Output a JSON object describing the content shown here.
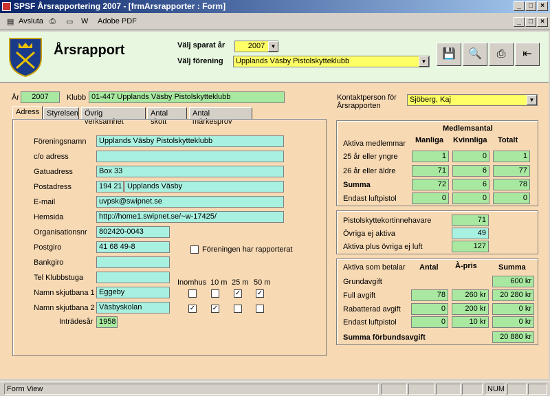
{
  "window": {
    "title": "SPSF Årsrapportering 2007 - [frmArsrapporter : Form]"
  },
  "menu": {
    "avsluta": "Avsluta",
    "adobe": "Adobe PDF"
  },
  "header": {
    "title": "Årsrapport",
    "year_label": "Välj sparat år",
    "year_value": "2007",
    "club_label": "Välj förening",
    "club_value": "Upplands Väsby Pistolskytteklubb"
  },
  "top": {
    "year_label": "År",
    "year_value": "2007",
    "club_label": "Klubb",
    "club_value": "01-447 Upplands Väsby Pistolskytteklubb"
  },
  "contact": {
    "label": "Kontaktperson för Årsrapporten",
    "value": "Sjöberg, Kaj"
  },
  "tabs": [
    "Adress",
    "Styrelsen",
    "Övrig verksamhet",
    "Antal skott",
    "Antal märkesprov"
  ],
  "adress": {
    "foreningsnamn_label": "Föreningsnamn",
    "foreningsnamn": "Upplands Väsby Pistolskytteklubb",
    "co_label": "c/o adress",
    "co": "",
    "gatu_label": "Gatuadress",
    "gatu": "Box 33",
    "post_label": "Postadress",
    "postnr": "194 21",
    "postort": "Upplands Väsby",
    "email_label": "E-mail",
    "email": "uvpsk@swipnet.se",
    "hemsida_label": "Hemsida",
    "hemsida": "http://home1.swipnet.se/~w-17425/",
    "orgnr_label": "Organisationsnr",
    "orgnr": "802420-0043",
    "postgiro_label": "Postgiro",
    "postgiro": " 41 68 49-8",
    "bankgiro_label": "Bankgiro",
    "bankgiro": "",
    "tel_label": "Tel Klubbstuga",
    "tel": "",
    "bana1_label": "Namn skjutbana 1",
    "bana1": "Eggeby",
    "bana2_label": "Namn skjutbana 2",
    "bana2": "Väsbyskolan",
    "intrade_label": "Inträdesår",
    "intrade": "1958",
    "rapporterat_label": "Föreningen har rapporterat",
    "col_inomhus": "Inomhus",
    "col_10": "10 m",
    "col_25": "25 m",
    "col_50": "50 m"
  },
  "members": {
    "heading": "Medlemsantal",
    "aktiva": "Aktiva medlemmar",
    "col_m": "Manliga",
    "col_k": "Kvinnliga",
    "col_t": "Totalt",
    "rows": [
      {
        "label": "25 år eller yngre",
        "m": "1",
        "k": "0",
        "t": "1"
      },
      {
        "label": "26 år eller äldre",
        "m": "71",
        "k": "6",
        "t": "77"
      },
      {
        "label": "Summa",
        "m": "72",
        "k": "6",
        "t": "78"
      },
      {
        "label": "Endast luftpistol",
        "m": "0",
        "k": "0",
        "t": "0"
      }
    ]
  },
  "cards": {
    "r1_label": "Pistolskyttekortinnehavare",
    "r1": "71",
    "r2_label": "Övriga ej aktiva",
    "r2": "49",
    "r3_label": "Aktiva plus övriga ej luft",
    "r3": "127"
  },
  "fees": {
    "head": "Aktiva som betalar",
    "col_antal": "Antal",
    "col_pris": "À-pris",
    "col_summa": "Summa",
    "grund_label": "Grundavgift",
    "grund_summa": "600 kr",
    "rows": [
      {
        "label": "Full avgift",
        "antal": "78",
        "pris": "260 kr",
        "summa": "20 280 kr"
      },
      {
        "label": "Rabatterad avgift",
        "antal": "0",
        "pris": "200 kr",
        "summa": "0 kr"
      },
      {
        "label": "Endast luftpistol",
        "antal": "0",
        "pris": "10 kr",
        "summa": "0 kr"
      }
    ],
    "total_label": "Summa förbundsavgift",
    "total": "20 880 kr"
  },
  "status": {
    "mode": "Form View",
    "num": "NUM"
  }
}
